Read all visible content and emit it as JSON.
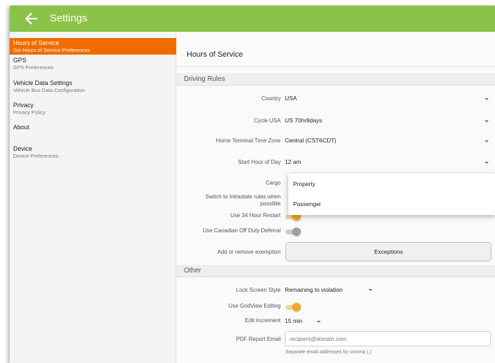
{
  "appbar": {
    "title": "Settings",
    "color": "#8bc34a"
  },
  "sidebar": {
    "items": [
      {
        "title": "Hours of Service",
        "subtitle": "Set Hours of Service Preferences",
        "active": true
      },
      {
        "title": "GPS",
        "subtitle": "GPS Preferences"
      },
      {
        "title": "Vehicle Data Settings",
        "subtitle": "Vehicle Bus Data Configuration"
      },
      {
        "title": "Privacy",
        "subtitle": "Privacy Policy"
      },
      {
        "title": "About",
        "subtitle": ""
      },
      {
        "title": "Device",
        "subtitle": "Device Preferences"
      }
    ],
    "active_color": "#ef6c00"
  },
  "main": {
    "heading": "Hours of Service",
    "driving_rules": {
      "header": "Driving Rules",
      "country": {
        "label": "Country",
        "value": "USA"
      },
      "cycle": {
        "label": "Cycle USA",
        "value": "US 70hr8days"
      },
      "timezone": {
        "label": "Home Terminal Time Zone",
        "value": "Central (CST6CDT)"
      },
      "start_hour": {
        "label": "Start Hour of Day",
        "value": "12 am"
      },
      "cargo": {
        "label": "Cargo",
        "options": [
          "Property",
          "Passenger"
        ]
      },
      "intrastate": {
        "label": "Switch to Intrastate rules when possible"
      },
      "restart_34": {
        "label": "Use 34 Hour Restart",
        "on": true
      },
      "canadian_deferral": {
        "label": "Use Canadian Off Duty Deferral",
        "on": false
      },
      "exemption": {
        "label": "Add or remove exemption",
        "button": "Exceptions"
      }
    },
    "other": {
      "header": "Other",
      "lock_screen": {
        "label": "Lock Screen Style",
        "value": "Remaining to violation"
      },
      "gridview": {
        "label": "Use GridView Editing",
        "on": true
      },
      "edit_increment": {
        "label": "Edit Increment",
        "value": "15 min"
      },
      "pdf_email": {
        "label": "PDF Report Email",
        "placeholder": "recipient@domain.com",
        "helper": "Separate email addresses by comma (,)"
      }
    }
  },
  "colors": {
    "toggle_on": "#f5a623",
    "toggle_off": "#9e9e9e"
  }
}
